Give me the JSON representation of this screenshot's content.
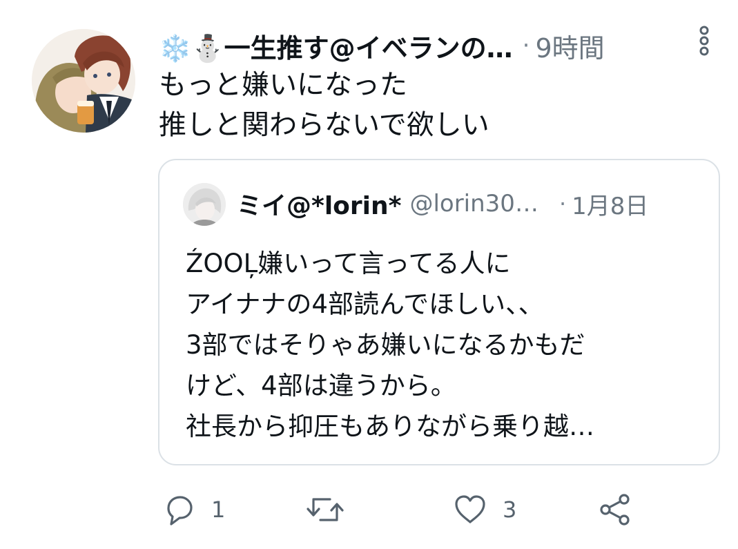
{
  "tweet": {
    "display_name": "❄️⛄一生推す@イベランの…",
    "separator": "·",
    "time": "9時間",
    "text": "もっと嫌いになった\n推しと関わらないで欲しい"
  },
  "quote": {
    "display_name": "ミイ@*lorin*",
    "handle": "@lorin30…",
    "separator": "·",
    "time": "1月8日",
    "text": "ŹOOĻ嫌いって言ってる人に\nアイナナの4部読んでほしい、、\n3部ではそりゃあ嫌いになるかもだ\nけど、4部は違うから。\n社長から抑圧もありながら乗り越…"
  },
  "actions": {
    "reply_count": "1",
    "like_count": "3"
  },
  "icons": {
    "more": "more-vertical-icon",
    "reply": "reply-icon",
    "retweet": "retweet-icon",
    "like": "heart-icon",
    "share": "share-icon"
  },
  "colors": {
    "text": "#0f1419",
    "secondary": "#6b7680",
    "icon": "#56626d",
    "border": "#dbe1e6"
  }
}
